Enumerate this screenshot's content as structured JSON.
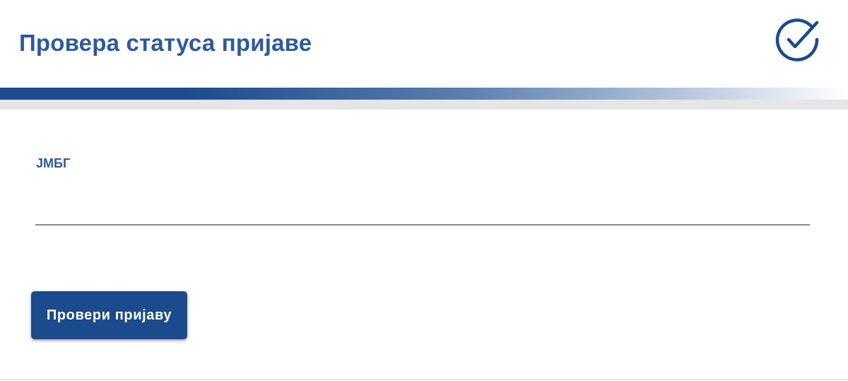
{
  "header": {
    "title": "Провера статуса пријаве",
    "icon": "check-circle-icon"
  },
  "form": {
    "jmbg_label": "ЈМБГ",
    "jmbg_value": "",
    "jmbg_placeholder": "",
    "submit_label": "Провери пријаву"
  },
  "colors": {
    "primary": "#1b4b8c",
    "title_text": "#2c5aa0",
    "underline": "#8a8a8a",
    "shadow_band": "#e6e6e6"
  }
}
